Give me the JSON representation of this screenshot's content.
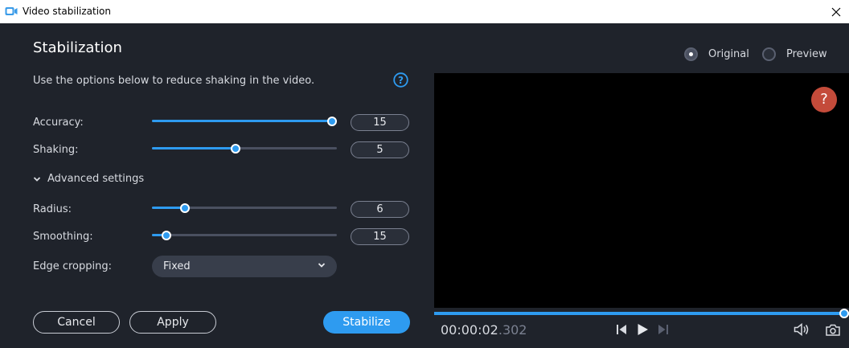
{
  "window": {
    "title": "Video stabilization"
  },
  "panel": {
    "heading": "Stabilization",
    "description": "Use the options below to reduce shaking in the video.",
    "sliders": [
      {
        "label": "Accuracy:",
        "value": "15",
        "fraction": 1.0
      },
      {
        "label": "Shaking:",
        "value": "5",
        "fraction": 0.45
      },
      {
        "label": "Radius:",
        "value": "6",
        "fraction": 0.18
      },
      {
        "label": "Smoothing:",
        "value": "15",
        "fraction": 0.08
      }
    ],
    "advanced_label": "Advanced settings",
    "edge_cropping": {
      "label": "Edge cropping:",
      "selected": "Fixed"
    }
  },
  "buttons": {
    "cancel": "Cancel",
    "apply": "Apply",
    "stabilize": "Stabilize"
  },
  "view_mode": {
    "options": [
      "Original",
      "Preview"
    ],
    "selected": "Original"
  },
  "player": {
    "help_glyph": "?",
    "time_main": "00:00:02",
    "time_ms": ".302",
    "progress": 1.0
  },
  "colors": {
    "accent": "#2e9bf0",
    "background": "#1f232b",
    "help_badge": "#c44b3a"
  },
  "icons": [
    "video-camera-icon",
    "close-icon",
    "help-icon",
    "chevron-down-icon",
    "previous-frame-icon",
    "play-icon",
    "next-frame-icon",
    "volume-icon",
    "snapshot-icon"
  ]
}
